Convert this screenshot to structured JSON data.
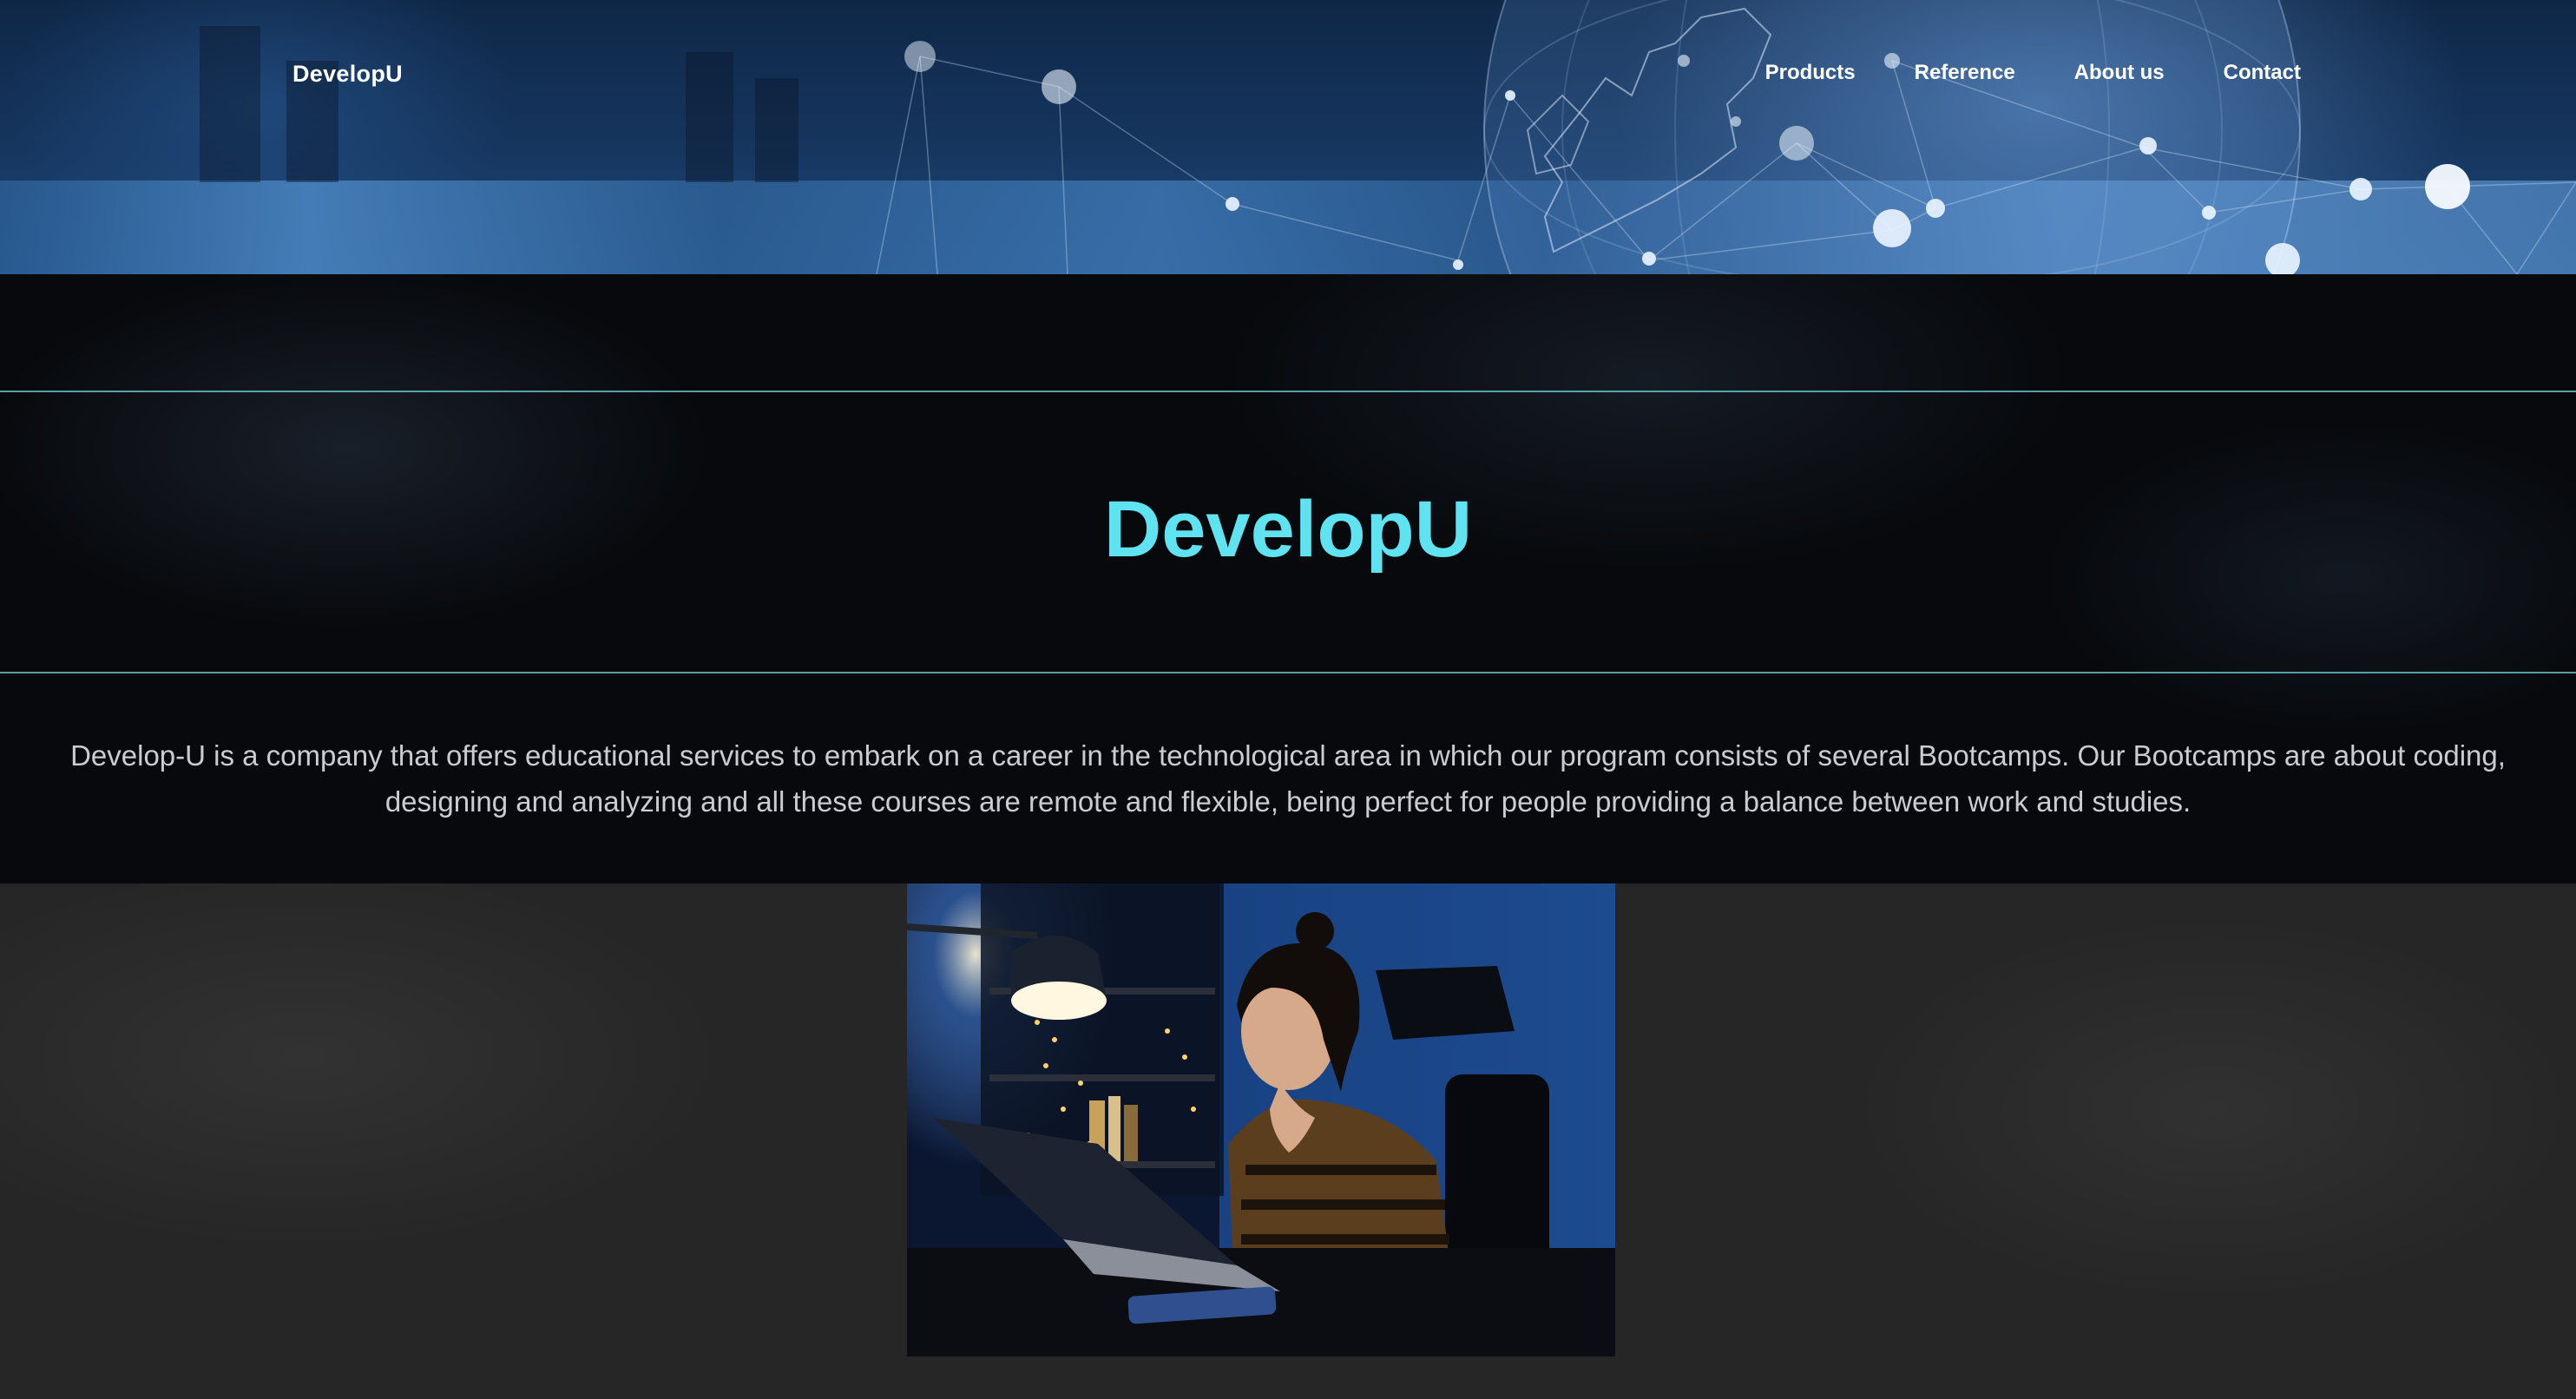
{
  "header": {
    "brand": "DevelopU",
    "nav": [
      {
        "label": "Products"
      },
      {
        "label": "Reference"
      },
      {
        "label": "About us"
      },
      {
        "label": "Contact"
      }
    ]
  },
  "intro": {
    "title": "DevelopU",
    "description": "Develop-U is a company that offers educational services to embark on a career in the technological area in which our program consists of several Bootcamps. Our Bootcamps are about coding, designing and analyzing and all these courses are remote and flexible, being perfect for people providing a balance between work and studies."
  },
  "colors": {
    "accent": "#5fe3f0",
    "intro_background": "#07090c",
    "lower_background": "#262626",
    "text_muted": "#c9ccd0"
  },
  "images": {
    "banner": "network-globe-banner",
    "photo": "woman-at-laptop-night-photo"
  }
}
